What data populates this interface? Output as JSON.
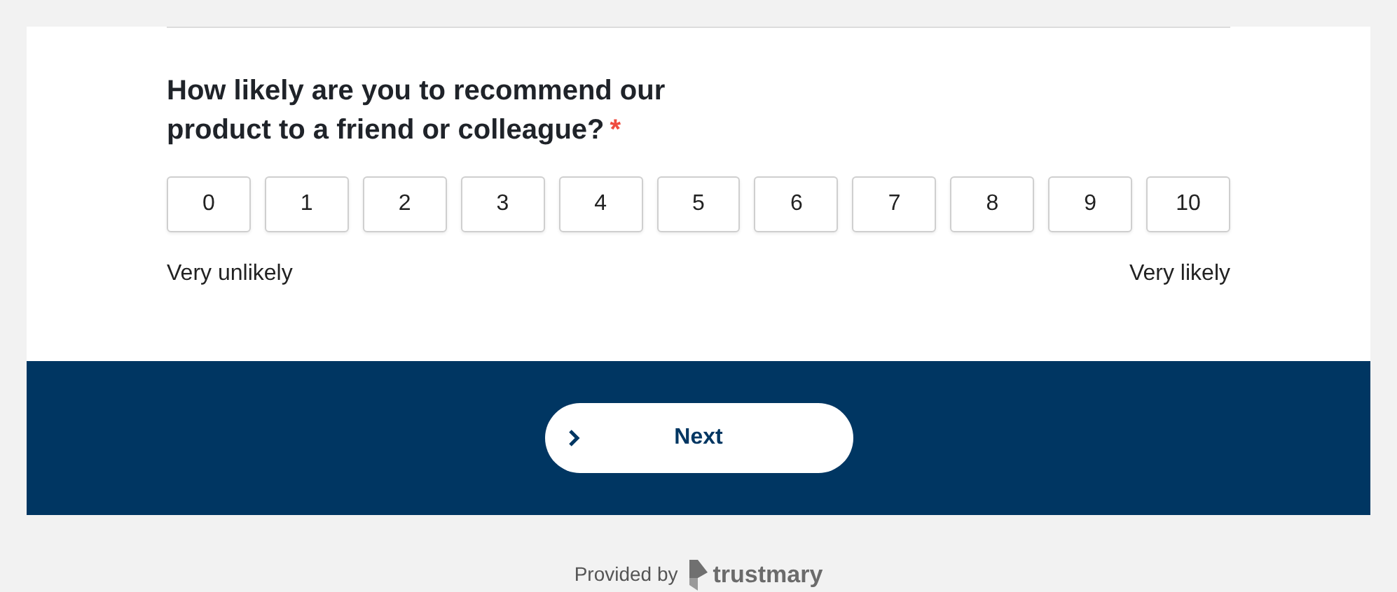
{
  "question": {
    "text": "How likely are you to recommend our product to a friend or colleague?",
    "required_mark": "*"
  },
  "scale": [
    {
      "label": "0",
      "selected": false
    },
    {
      "label": "1",
      "selected": false
    },
    {
      "label": "2",
      "selected": false
    },
    {
      "label": "3",
      "selected": false
    },
    {
      "label": "4",
      "selected": false
    },
    {
      "label": "5",
      "selected": false
    },
    {
      "label": "6",
      "selected": false
    },
    {
      "label": "7",
      "selected": false
    },
    {
      "label": "8",
      "selected": false
    },
    {
      "label": "9",
      "selected": false
    },
    {
      "label": "10",
      "selected": false
    }
  ],
  "scale_labels": {
    "low": "Very unlikely",
    "high": "Very likely"
  },
  "next_button": {
    "label": "Next"
  },
  "footer": {
    "provided_by": "Provided by",
    "brand": "trustmary"
  }
}
